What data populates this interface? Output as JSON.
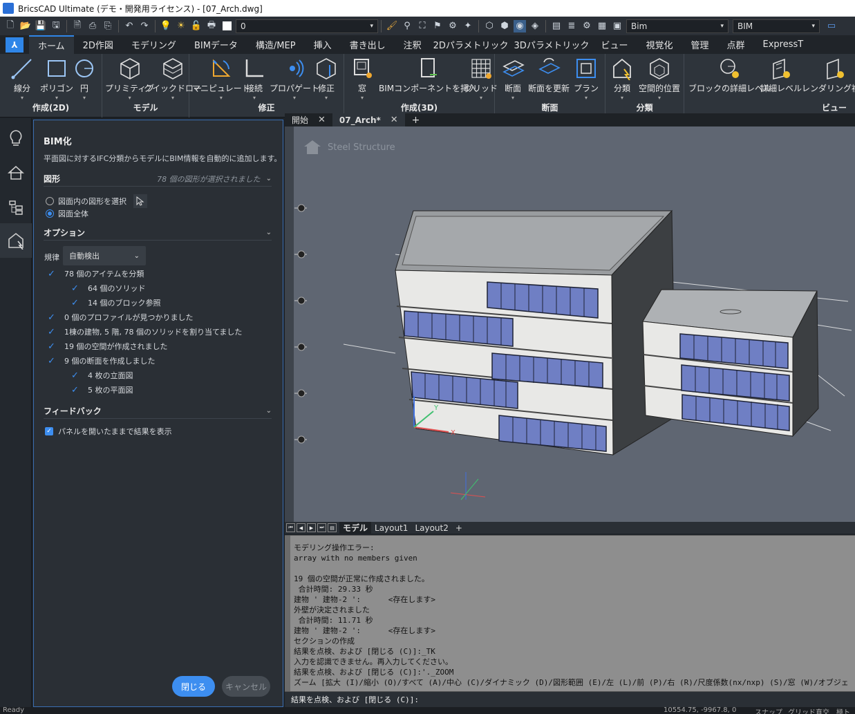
{
  "window": {
    "title": "BricsCAD Ultimate (デモ・開発用ライセンス) - [07_Arch.dwg]"
  },
  "qat": {
    "layer_value": "0",
    "workspace_value": "Bim",
    "visualstyle_value": "BIM"
  },
  "ribbon_tabs": [
    "ホーム",
    "2D作図",
    "モデリング",
    "BIMデータ",
    "構造/MEP",
    "挿入",
    "書き出し",
    "注釈",
    "2Dパラメトリック",
    "3Dパラメトリック",
    "ビュー",
    "視覚化",
    "管理",
    "点群",
    "ExpressT"
  ],
  "ribbon_groups": {
    "create2d": {
      "title": "作成(2D)",
      "buttons": [
        "線分",
        "ポリゴン",
        "円"
      ]
    },
    "model": {
      "title": "モデル",
      "buttons": [
        "プリミティブ",
        "クイックドロー"
      ]
    },
    "modify": {
      "title": "修正",
      "buttons": [
        "マニピュレート",
        "接続",
        "プロパゲート",
        "修正"
      ]
    },
    "create3d": {
      "title": "作成(3D)",
      "buttons": [
        "窓",
        "BIMコンポーネントを挿入",
        "グリッド"
      ]
    },
    "section": {
      "title": "断面",
      "buttons": [
        "断面",
        "断面を更新",
        "プラン"
      ]
    },
    "classify": {
      "title": "分類",
      "buttons": [
        "分類",
        "空間的位置"
      ]
    },
    "view": {
      "title": "ビュー",
      "buttons": [
        "ブロックの詳細レベル",
        "詳細レベル",
        "レンダリング複合"
      ]
    }
  },
  "panel": {
    "title": "BIM化",
    "description": "平面図に対するIFC分類からモデルにBIM情報を自動的に追加します。",
    "shapes_header": "図形",
    "shapes_status": "78 個の図形が選択されました",
    "radio_select": "図面内の図形を選択",
    "radio_all": "図面全体",
    "options_header": "オプション",
    "rule_label": "規律",
    "rule_value": "自動検出",
    "results": [
      "78 個のアイテムを分類",
      "64 個のソリッド",
      "14 個のブロック参照",
      "0 個のプロファイルが見つかりました",
      "1棟の建物, 5 階, 78 個のソリッドを割り当てました",
      "19 個の空間が作成されました",
      "9 個の断面を作成しました",
      "4 枚の立面図",
      "5 枚の平面図"
    ],
    "feedback_header": "フィードバック",
    "feedback_check": "パネルを開いたままで結果を表示",
    "close_button": "閉じる",
    "cancel_button": "キャンセル"
  },
  "doc_tabs": [
    "開始",
    "07_Arch*"
  ],
  "viewport": {
    "label": "Steel Structure"
  },
  "layout_tabs": [
    "モデル",
    "Layout1",
    "Layout2"
  ],
  "command_history": "モデリング操作エラー:\narray with no members given\n\n19 個の空間が正常に作成されました。\n 合計時間: 29.33 秒\n建物 ' 建物-2 ':      <存在します>\n外壁が決定されました\n 合計時間: 11.71 秒\n建物 ' 建物-2 ':      <存在します>\nセクションの作成\n結果を点検、および [閉じる (C)]:_TK\n入力を認識できません。再入力してください。\n結果を点検、および [閉じる (C)]:'._ZOOM\nズーム [拡大 (I)/縮小 (O)/すべて (A)/中心 (C)/ダイナミック (D)/図形範囲 (E)/左 (L)/前 (P)/右 (R)/尺度係数(nx/nxp) (S)/窓 (W)/オブジェ",
  "command_prompt": "結果を点検、および [閉じる (C)]:",
  "status": {
    "ready": "Ready",
    "coords": "10554.75, -9967.8, 0",
    "snap": "スナップ",
    "grid": "グリッド",
    "ortho": "直交",
    "polar": "極トラ"
  }
}
